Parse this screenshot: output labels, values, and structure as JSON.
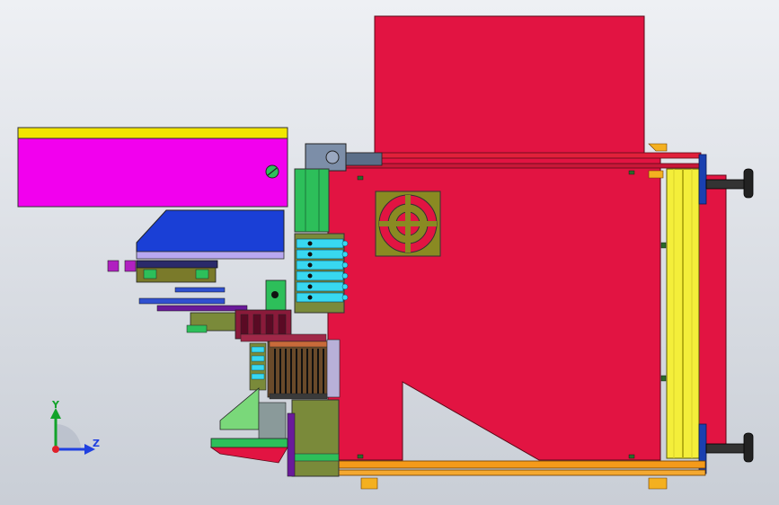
{
  "viewport": {
    "background_top": "#eef0f4",
    "background_bottom": "#c9ced6"
  },
  "colors": {
    "panel_red": "#e21442",
    "hopper_magenta": "#f200ee",
    "hopper_yellow": "#f2e600",
    "ramp_blue": "#1a3fd6",
    "frame_yellow": "#f4ee3a",
    "rail_orange": "#f49a1a",
    "valve_cyan": "#38d8f0",
    "olive": "#7a8a3a",
    "green": "#2dbf5a",
    "maroon": "#8a1a3a",
    "purple": "#6a1a9a",
    "knob_black": "#222222",
    "foot_blue": "#1a40b0"
  },
  "icons": {
    "fan": "fan-icon",
    "triad": "coordinate-triad-icon"
  },
  "triad": {
    "y_label": "Y",
    "z_label": "Z"
  }
}
